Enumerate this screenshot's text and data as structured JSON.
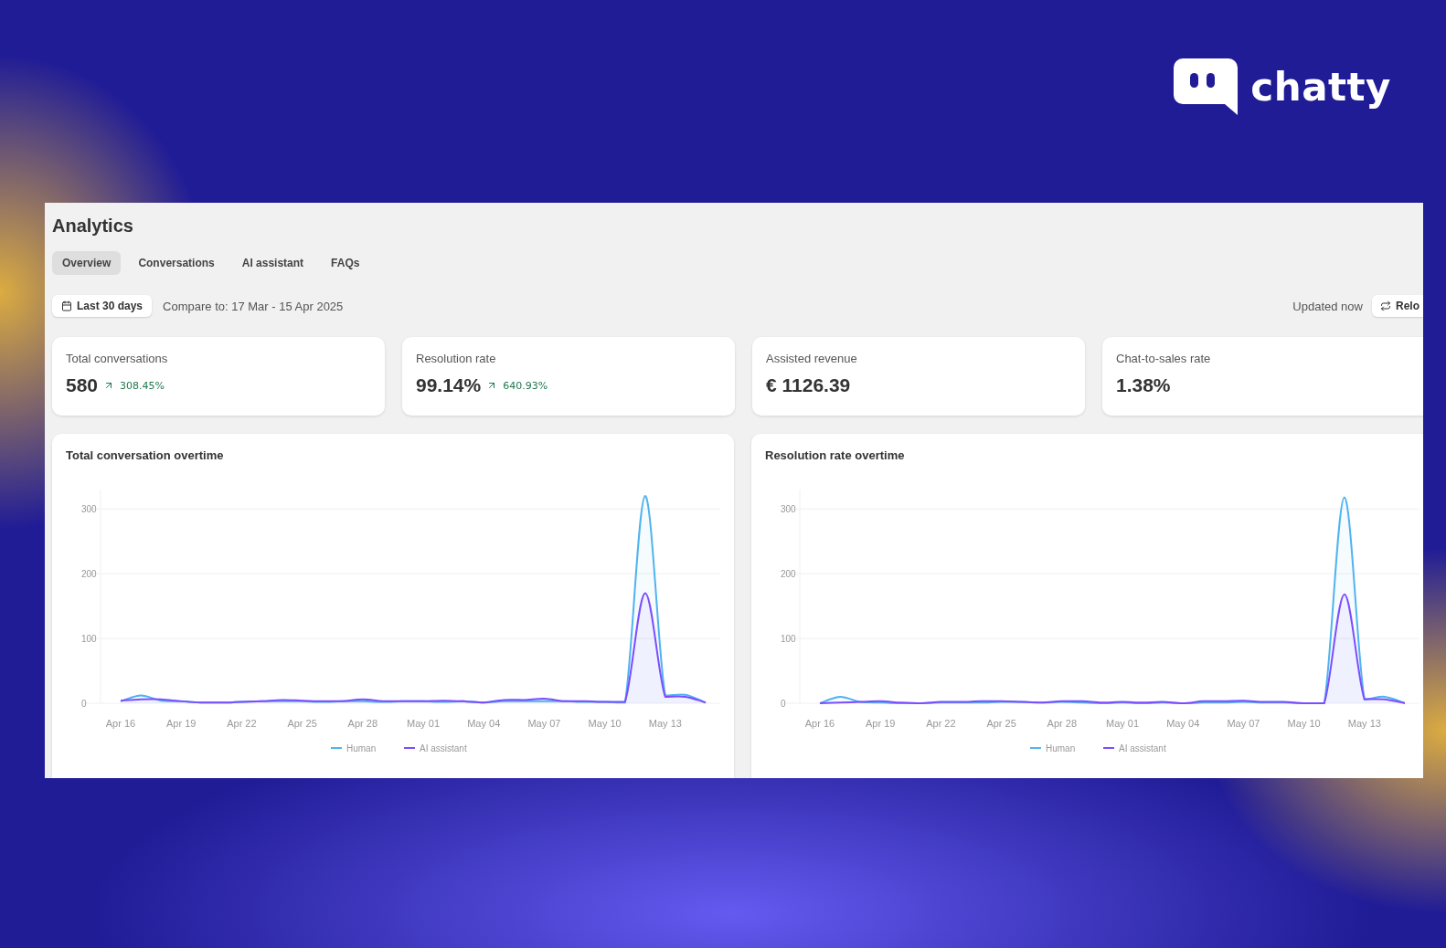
{
  "brand": {
    "name": "chatty"
  },
  "page": {
    "title": "Analytics",
    "tabs": [
      {
        "label": "Overview",
        "selected": true
      },
      {
        "label": "Conversations",
        "selected": false
      },
      {
        "label": "AI assistant",
        "selected": false
      },
      {
        "label": "FAQs",
        "selected": false
      }
    ],
    "date_range": "Last 30 days",
    "compare": "Compare to: 17 Mar - 15 Apr 2025",
    "updated": "Updated now",
    "reload": "Relo",
    "kpis": [
      {
        "label": "Total conversations",
        "value": "580",
        "change": "308.45%"
      },
      {
        "label": "Resolution rate",
        "value": "99.14%",
        "change": "640.93%"
      },
      {
        "label": "Assisted revenue",
        "value": "€ 1126.39"
      },
      {
        "label": "Chat-to-sales rate",
        "value": "1.38%"
      }
    ],
    "charts": [
      {
        "title": "Total conversation overtime",
        "chart_data": {
          "type": "line",
          "ylim": [
            0,
            330
          ],
          "yticks": [
            0,
            100,
            200,
            300
          ],
          "grid": true,
          "legend": true,
          "categories": [
            "Apr 16",
            null,
            null,
            "Apr 19",
            null,
            null,
            "Apr 22",
            null,
            null,
            "Apr 25",
            null,
            null,
            "Apr 28",
            null,
            null,
            "May 01",
            null,
            null,
            "May 04",
            null,
            null,
            "May 07",
            null,
            null,
            "May 10",
            null,
            null,
            "May 13",
            null,
            null
          ],
          "series": [
            {
              "name": "Human",
              "color": "#4fb3f0",
              "values": [
                3,
                12,
                4,
                3,
                1,
                1,
                2,
                3,
                3,
                3,
                2,
                3,
                3,
                2,
                3,
                3,
                2,
                3,
                1,
                3,
                3,
                3,
                3,
                2,
                2,
                1,
                320,
                12,
                13,
                1
              ]
            },
            {
              "name": "AI assistant",
              "color": "#7c4dff",
              "values": [
                4,
                6,
                6,
                3,
                1,
                1,
                2,
                3,
                5,
                4,
                3,
                3,
                6,
                3,
                3,
                3,
                4,
                3,
                1,
                5,
                5,
                7,
                3,
                3,
                2,
                2,
                170,
                10,
                10,
                1
              ]
            }
          ]
        }
      },
      {
        "title": "Resolution rate overtime",
        "chart_data": {
          "type": "line",
          "ylim": [
            0,
            330
          ],
          "yticks": [
            0,
            100,
            200,
            300
          ],
          "grid": true,
          "legend": true,
          "categories": [
            "Apr 16",
            null,
            null,
            "Apr 19",
            null,
            null,
            "Apr 22",
            null,
            null,
            "Apr 25",
            null,
            null,
            "Apr 28",
            null,
            null,
            "May 01",
            null,
            null,
            "May 04",
            null,
            null,
            "May 07",
            null,
            null,
            "May 10",
            null,
            null,
            "May 13",
            null,
            null
          ],
          "series": [
            {
              "name": "Human",
              "color": "#4fb3f0",
              "values": [
                0,
                10,
                2,
                1,
                0,
                0,
                1,
                1,
                1,
                2,
                2,
                1,
                2,
                1,
                0,
                1,
                0,
                1,
                0,
                1,
                1,
                2,
                1,
                1,
                0,
                0,
                318,
                6,
                10,
                0
              ]
            },
            {
              "name": "AI assistant",
              "color": "#7c4dff",
              "values": [
                0,
                1,
                2,
                3,
                1,
                0,
                2,
                2,
                3,
                3,
                2,
                1,
                3,
                3,
                1,
                2,
                1,
                2,
                0,
                3,
                3,
                4,
                2,
                2,
                0,
                0,
                168,
                6,
                6,
                0
              ]
            }
          ]
        }
      }
    ]
  }
}
